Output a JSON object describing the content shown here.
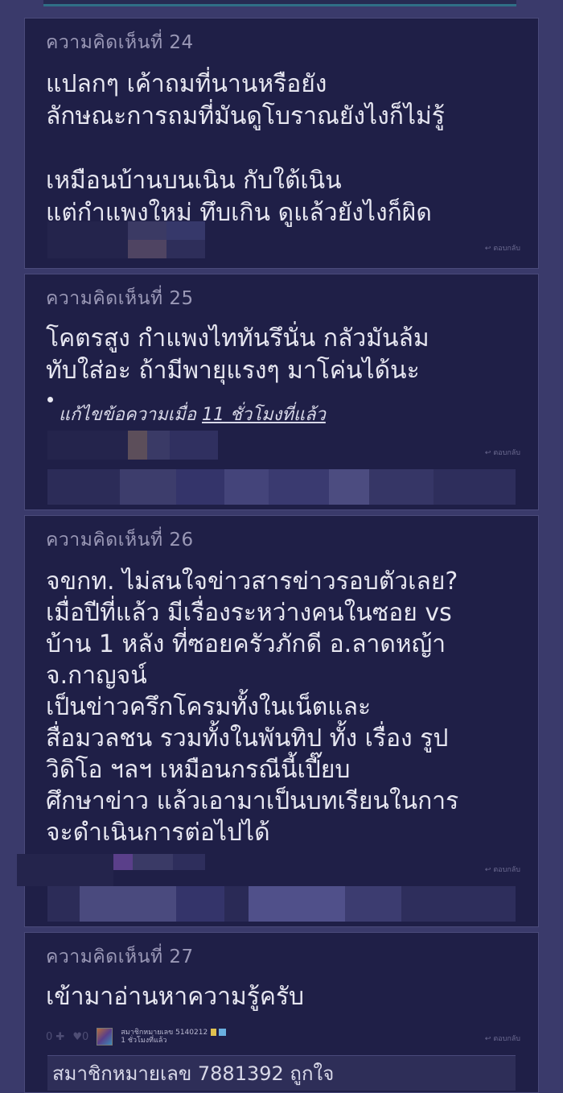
{
  "comments": [
    {
      "header": "ความคิดเห็นที่ 24",
      "body": "แปลกๆ เค้าถมที่นานหรือยัง\nลักษณะการถมที่มันดูโบราณยังไงก็ไม่รู้\n\nเหมือนบ้านบนเนิน กับใต้เนิน\nแต่กำแพงใหม่ ทึบเกิน ดูแล้วยังไงก็ผิด",
      "reply_label": "ตอบกลับ"
    },
    {
      "header": "ความคิดเห็นที่ 25",
      "body": "โคตรสูง กำแพงไททันรึนั่น กลัวมันล้ม\nทับใส่อะ ถ้ามีพายุแรงๆ มาโค่นได้นะ",
      "edit_prefix": "แก้ไขข้อความเมื่อ ",
      "edit_time": "11 ชั่วโมงที่แล้ว",
      "reply_label": "ตอบกลับ"
    },
    {
      "header": "ความคิดเห็นที่ 26",
      "body": "จขกท. ไม่สนใจข่าวสารข่าวรอบตัวเลย?\nเมื่อปีที่แล้ว มีเรื่องระหว่างคนในซอย vs\nบ้าน 1 หลัง ที่ซอยครัวภักดี อ.ลาดหญ้า\nจ.กาญจน์\nเป็นข่าวครึกโครมทั้งในเน็ตและ\nสื่อมวลชน รวมทั้งในพันทิป ทั้ง เรื่อง รูป\nวิดิโอ ฯลฯ เหมือนกรณีนี้เปี๊ยบ\nศึกษาข่าว แล้วเอามาเป็นบทเรียนในการ\nจะดำเนินการต่อไปได้",
      "reply_label": "ตอบกลับ"
    },
    {
      "header": "ความคิดเห็นที่ 27",
      "body": "เข้ามาอ่านหาความรู้ครับ",
      "member_name": "สมาชิกหมายเลข 5140212",
      "member_time": "1 ชั่วโมงที่แล้ว",
      "vote_up": "0",
      "vote_down": "0",
      "reply_label": "ตอบกลับ",
      "like_text": "สมาชิกหมายเลข 7881392 ถูกใจ"
    }
  ],
  "icons": {
    "reply": "reply-arrow-icon",
    "plus": "plus-icon",
    "heart": "emotion-icon"
  },
  "colors": {
    "background": "#3a3a6b",
    "card": "#1f1f47",
    "header_text": "#9a98b6",
    "body_text": "#e6e6f0"
  }
}
